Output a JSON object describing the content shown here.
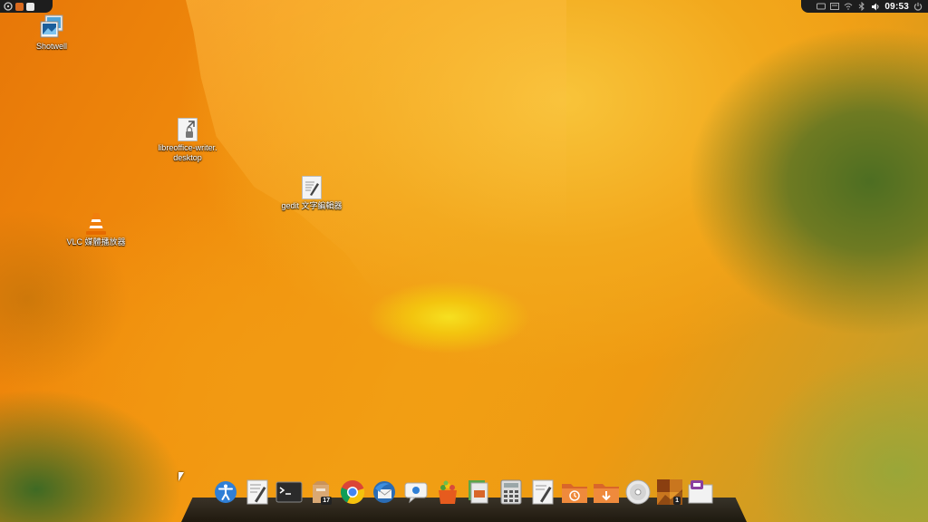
{
  "desktop": {
    "icons": [
      {
        "label": "Shotwell"
      },
      {
        "label": "libreoffice-writer.\ndesktop"
      },
      {
        "label": "gedit 文字編輯器"
      },
      {
        "label": "VLC 媒體播放器"
      }
    ]
  },
  "topbar": {
    "clock": "09:53",
    "left_icons": [
      "ubuntu-logo-icon",
      "files-icon",
      "documents-icon"
    ],
    "right_icons": [
      "keyboard-icon",
      "messaging-icon",
      "wifi-icon",
      "bluetooth-icon",
      "volume-icon",
      "power-icon"
    ]
  },
  "dock": {
    "items": [
      {
        "icon": "accessibility-icon"
      },
      {
        "icon": "text-editor-icon"
      },
      {
        "icon": "terminal-icon"
      },
      {
        "icon": "calendar-icon",
        "badge": "17"
      },
      {
        "icon": "chrome-icon"
      },
      {
        "icon": "thunderbird-icon"
      },
      {
        "icon": "chat-icon"
      },
      {
        "icon": "store-icon"
      },
      {
        "icon": "presentation-icon"
      },
      {
        "icon": "calculator-icon"
      },
      {
        "icon": "notes-icon"
      },
      {
        "icon": "backup-folder-icon"
      },
      {
        "icon": "downloads-folder-icon"
      },
      {
        "icon": "disc-icon"
      },
      {
        "icon": "photos-icon",
        "badge": "1"
      },
      {
        "icon": "screen-icon"
      }
    ]
  },
  "colors": {
    "topbar": "#1d1d1d",
    "dock": "#1a1a1a",
    "wallpaper_primary": "#f3a214"
  }
}
